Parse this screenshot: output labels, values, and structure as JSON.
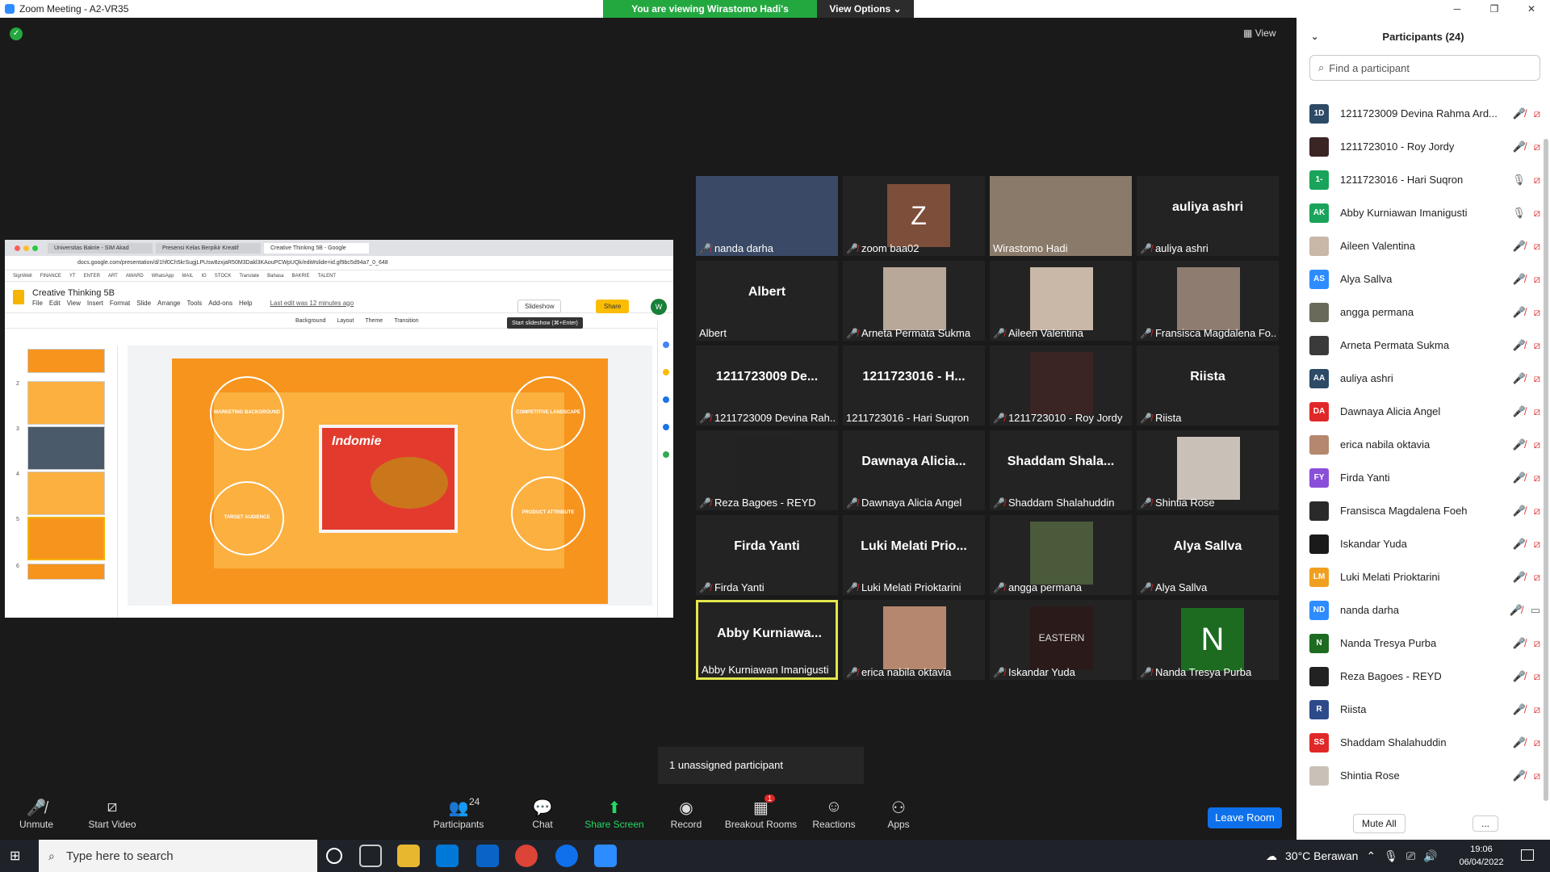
{
  "window": {
    "title": "Zoom Meeting - A2-VR35",
    "minimize": "─",
    "restore": "❐",
    "close": "✕"
  },
  "banner": {
    "message": "You are viewing Wirastomo Hadi's screen",
    "options": "View Options"
  },
  "view_label": "View",
  "shared_screen": {
    "tabs": [
      "Universitas Bakrie - SIM Akad",
      "Presensi Kelas Berpikir Kreatif",
      "Creative Thinking 5B - Google"
    ],
    "url": "docs.google.com/presentation/d/1hf0Ch5krSugjLPUsw8zxjaR50M3Dakl3KAouPCWpUQk/edit#slide=id.gf9bc5d94a7_0_648",
    "bookmarks": [
      "SignWell",
      "FINANCE",
      "YT",
      "ENTER",
      "ART",
      "AWARD",
      "WhatsApp",
      "MAIL",
      "IG",
      "STOCK",
      "Translate",
      "Bahasa",
      "BAKRIE",
      "TALENT"
    ],
    "doc_title": "Creative Thinking 5B",
    "menus": [
      "File",
      "Edit",
      "View",
      "Insert",
      "Format",
      "Slide",
      "Arrange",
      "Tools",
      "Add-ons",
      "Help"
    ],
    "last_edit": "Last edit was 12 minutes ago",
    "slideshow": "Slideshow",
    "share": "Share",
    "avatar": "W",
    "tooltip": "Start slideshow (⌘+Enter)",
    "toolbar": [
      "Background",
      "Layout",
      "Theme",
      "Transition"
    ],
    "slide_numbers": [
      "2",
      "3",
      "4",
      "5",
      "6"
    ],
    "slide": {
      "circles": [
        "MARKETING BACKGROUND",
        "COMPETITIVE LANDSCAPE",
        "TARGET AUDIENCE",
        "PRODUCT ATTRIBUTE"
      ],
      "brand": "Indomie"
    }
  },
  "tiles": [
    {
      "name": "nanda darha",
      "big": "",
      "kind": "video",
      "color": "#3a4a66"
    },
    {
      "name": "zoom baa02",
      "big": "",
      "kind": "z",
      "initial": "Z"
    },
    {
      "name": "Wirastomo Hadi",
      "big": "",
      "kind": "video",
      "color": "#8a7a6a"
    },
    {
      "name": "auliya ashri",
      "big": "auliya ashri",
      "kind": "text"
    },
    {
      "name": "Albert",
      "big": "Albert",
      "kind": "text"
    },
    {
      "name": "Arneta Permata Sukma",
      "big": "",
      "kind": "photo",
      "color": "#b8a89a"
    },
    {
      "name": "Aileen Valentina",
      "big": "",
      "kind": "photo",
      "color": "#c9b7a8"
    },
    {
      "name": "Fransisca Magdalena Fo...",
      "big": "",
      "kind": "photo",
      "color": "#8f7c70"
    },
    {
      "name": "1211723009 Devina Rah...",
      "big": "1211723009 De...",
      "kind": "text"
    },
    {
      "name": "1211723016 - Hari Suqron",
      "big": "1211723016 - H...",
      "kind": "text"
    },
    {
      "name": "1211723010 - Roy Jordy",
      "big": "",
      "kind": "photo",
      "color": "#3b2424"
    },
    {
      "name": "Riista",
      "big": "Riista",
      "kind": "text"
    },
    {
      "name": "Reza Bagoes - REYD",
      "big": "",
      "kind": "photo",
      "color": "#222222"
    },
    {
      "name": "Dawnaya Alicia Angel",
      "big": "Dawnaya  Alicia...",
      "kind": "text"
    },
    {
      "name": "Shaddam Shalahuddin",
      "big": "Shaddam  Shala...",
      "kind": "text"
    },
    {
      "name": "Shintia Rose",
      "big": "",
      "kind": "photo",
      "color": "#c9c1b8"
    },
    {
      "name": "Firda Yanti",
      "big": "Firda Yanti",
      "kind": "text"
    },
    {
      "name": "Luki Melati Prioktarini",
      "big": "Luki Melati Prio...",
      "kind": "text"
    },
    {
      "name": "angga permana",
      "big": "",
      "kind": "photo",
      "color": "#4a5a3a"
    },
    {
      "name": "Alya Sallva",
      "big": "Alya Sallva",
      "kind": "text"
    },
    {
      "name": "Abby Kurniawan Imanigusti",
      "big": "Abby  Kurniawa...",
      "kind": "text",
      "active": true
    },
    {
      "name": "erica nabila oktavia",
      "big": "",
      "kind": "photo",
      "color": "#b5876e"
    },
    {
      "name": "Iskandar Yuda",
      "big": "",
      "kind": "photo",
      "color": "#2a1a1a",
      "photo_text": "EASTERN"
    },
    {
      "name": "Nanda Tresya Purba",
      "big": "",
      "kind": "n",
      "initial": "N"
    }
  ],
  "unassigned": "1 unassigned participant",
  "toolbar": {
    "unmute": "Unmute",
    "start_video": "Start Video",
    "participants": "Participants",
    "participants_count": "24",
    "chat": "Chat",
    "share_screen": "Share Screen",
    "record": "Record",
    "breakout_rooms": "Breakout Rooms",
    "breakout_badge": "1",
    "reactions": "Reactions",
    "apps": "Apps",
    "leave": "Leave Room"
  },
  "panel": {
    "title": "Participants (24)",
    "search_placeholder": "Find a participant",
    "participants": [
      {
        "initials": "1D",
        "name": "1211723009 Devina Rahma Ard...",
        "color": "#2d4a66",
        "mic": "muted",
        "video": "off"
      },
      {
        "initials": "",
        "name": "1211723010 - Roy Jordy",
        "color": "#3b2424",
        "mic": "muted",
        "video": "off"
      },
      {
        "initials": "1-",
        "name": "1211723016 - Hari Suqron",
        "color": "#1aa35a",
        "mic": "on",
        "video": "off"
      },
      {
        "initials": "AK",
        "name": "Abby Kurniawan Imanigusti",
        "color": "#1aa35a",
        "mic": "on",
        "video": "off"
      },
      {
        "initials": "",
        "name": "Aileen Valentina",
        "color": "#c9b7a8",
        "mic": "muted",
        "video": "off"
      },
      {
        "initials": "AS",
        "name": "Alya Sallva",
        "color": "#2d8cff",
        "mic": "muted",
        "video": "off"
      },
      {
        "initials": "",
        "name": "angga permana",
        "color": "#6a6a5a",
        "mic": "muted",
        "video": "off"
      },
      {
        "initials": "",
        "name": "Arneta Permata Sukma",
        "color": "#3a3a3a",
        "mic": "muted",
        "video": "off"
      },
      {
        "initials": "AA",
        "name": "auliya ashri",
        "color": "#2d4a66",
        "mic": "muted",
        "video": "off"
      },
      {
        "initials": "DA",
        "name": "Dawnaya Alicia Angel",
        "color": "#e02828",
        "mic": "muted",
        "video": "off"
      },
      {
        "initials": "",
        "name": "erica nabila oktavia",
        "color": "#b5876e",
        "mic": "muted",
        "video": "off"
      },
      {
        "initials": "FY",
        "name": "Firda Yanti",
        "color": "#8a4fd8",
        "mic": "muted",
        "video": "off"
      },
      {
        "initials": "",
        "name": "Fransisca Magdalena Foeh",
        "color": "#2a2a2a",
        "mic": "muted",
        "video": "off"
      },
      {
        "initials": "",
        "name": "Iskandar Yuda",
        "color": "#1a1a1a",
        "mic": "muted",
        "video": "off"
      },
      {
        "initials": "LM",
        "name": "Luki Melati Prioktarini",
        "color": "#f0a020",
        "mic": "muted",
        "video": "off"
      },
      {
        "initials": "ND",
        "name": "nanda darha",
        "color": "#2d8cff",
        "mic": "muted",
        "video": "on"
      },
      {
        "initials": "N",
        "name": "Nanda Tresya Purba",
        "color": "#1d6b21",
        "mic": "muted",
        "video": "off"
      },
      {
        "initials": "",
        "name": "Reza Bagoes - REYD",
        "color": "#222222",
        "mic": "muted",
        "video": "off"
      },
      {
        "initials": "R",
        "name": "Riista",
        "color": "#2d4a8a",
        "mic": "muted",
        "video": "off"
      },
      {
        "initials": "SS",
        "name": "Shaddam Shalahuddin",
        "color": "#e02828",
        "mic": "muted",
        "video": "off"
      },
      {
        "initials": "",
        "name": "Shintia Rose",
        "color": "#c9c1b8",
        "mic": "muted",
        "video": "off"
      }
    ],
    "mute_all": "Mute All",
    "more": "..."
  },
  "taskbar": {
    "search": "Type here to search",
    "weather": "30°C  Berawan",
    "time": "19:06",
    "date": "06/04/2022"
  }
}
